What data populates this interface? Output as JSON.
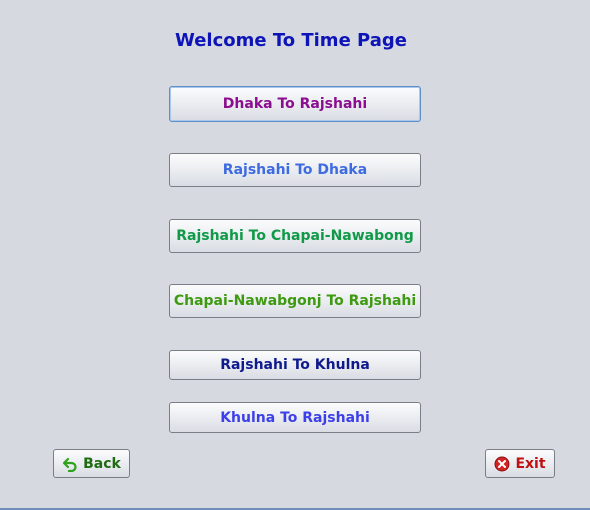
{
  "page": {
    "title": "Welcome To Time Page"
  },
  "routes": [
    {
      "label": "Dhaka To Rajshahi",
      "color": "#8a0e8f"
    },
    {
      "label": "Rajshahi To Dhaka",
      "color": "#3e6be0"
    },
    {
      "label": "Rajshahi To Chapai-Nawabong",
      "color": "#109a48"
    },
    {
      "label": "Chapai-Nawabgonj To Rajshahi",
      "color": "#3e9a10"
    },
    {
      "label": "Rajshahi To Khulna",
      "color": "#0f1a8c"
    },
    {
      "label": "Khulna To Rajshahi",
      "color": "#3d3fe8"
    }
  ],
  "nav": {
    "back_label": "Back",
    "back_color": "#1f6b12",
    "back_icon": "back-arrow-icon",
    "exit_label": "Exit",
    "exit_color": "#c01010",
    "exit_icon": "close-circle-icon"
  }
}
